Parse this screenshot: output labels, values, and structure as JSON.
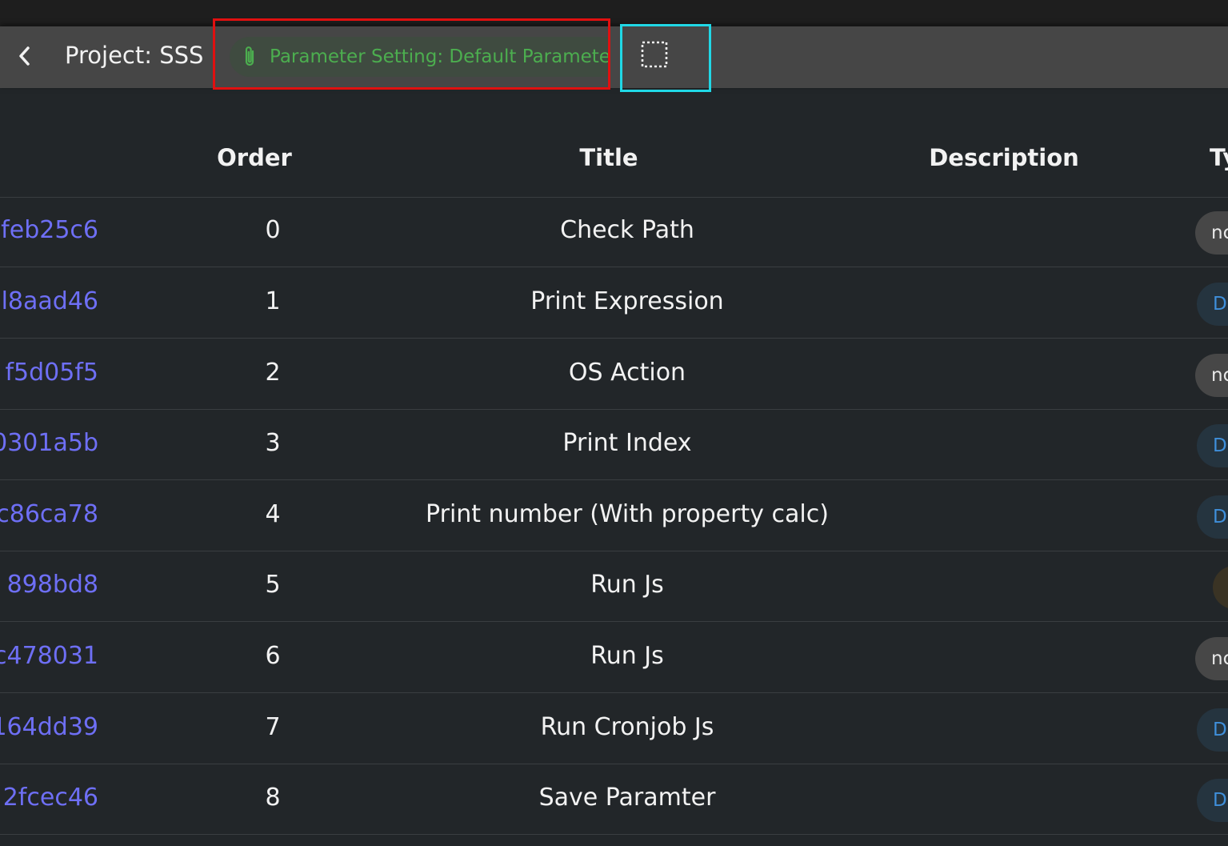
{
  "header": {
    "project_title": "Project: SSS",
    "parameter_chip": "Parameter Setting: Default Parameter",
    "back_icon": "chevron-left-icon",
    "clip_icon": "paperclip-icon",
    "select_icon": "dashed-selection-icon"
  },
  "table": {
    "columns": [
      "Order",
      "Title",
      "Description",
      "Ty"
    ],
    "rows": [
      {
        "id": "feb25c6",
        "order": "0",
        "title": "Check Path",
        "description": "",
        "type": "nc",
        "type_kind": "none"
      },
      {
        "id": "l8aad46",
        "order": "1",
        "title": "Print Expression",
        "description": "",
        "type": "D",
        "type_kind": "def"
      },
      {
        "id": "f5d05f5",
        "order": "2",
        "title": "OS Action",
        "description": "",
        "type": "nc",
        "type_kind": "none"
      },
      {
        "id": "0301a5b",
        "order": "3",
        "title": "Print Index",
        "description": "",
        "type": "D",
        "type_kind": "def"
      },
      {
        "id": "c86ca78",
        "order": "4",
        "title": "Print number (With property calc)",
        "description": "",
        "type": "D",
        "type_kind": "def"
      },
      {
        "id": "898bd8",
        "order": "5",
        "title": "Run Js",
        "description": "",
        "type": "",
        "type_kind": "other"
      },
      {
        "id": "c478031",
        "order": "6",
        "title": "Run Js",
        "description": "",
        "type": "nc",
        "type_kind": "none"
      },
      {
        "id": "164dd39",
        "order": "7",
        "title": "Run Cronjob Js",
        "description": "",
        "type": "D",
        "type_kind": "def"
      },
      {
        "id": "2fcec46",
        "order": "8",
        "title": "Save Paramter",
        "description": "",
        "type": "D",
        "type_kind": "def"
      }
    ]
  },
  "colors": {
    "background": "#222629",
    "toolbar": "#464646",
    "id_link": "#6e6ff5",
    "chip_text": "#4cae4f",
    "highlight_red": "#e01010",
    "highlight_cyan": "#20d8e6"
  }
}
